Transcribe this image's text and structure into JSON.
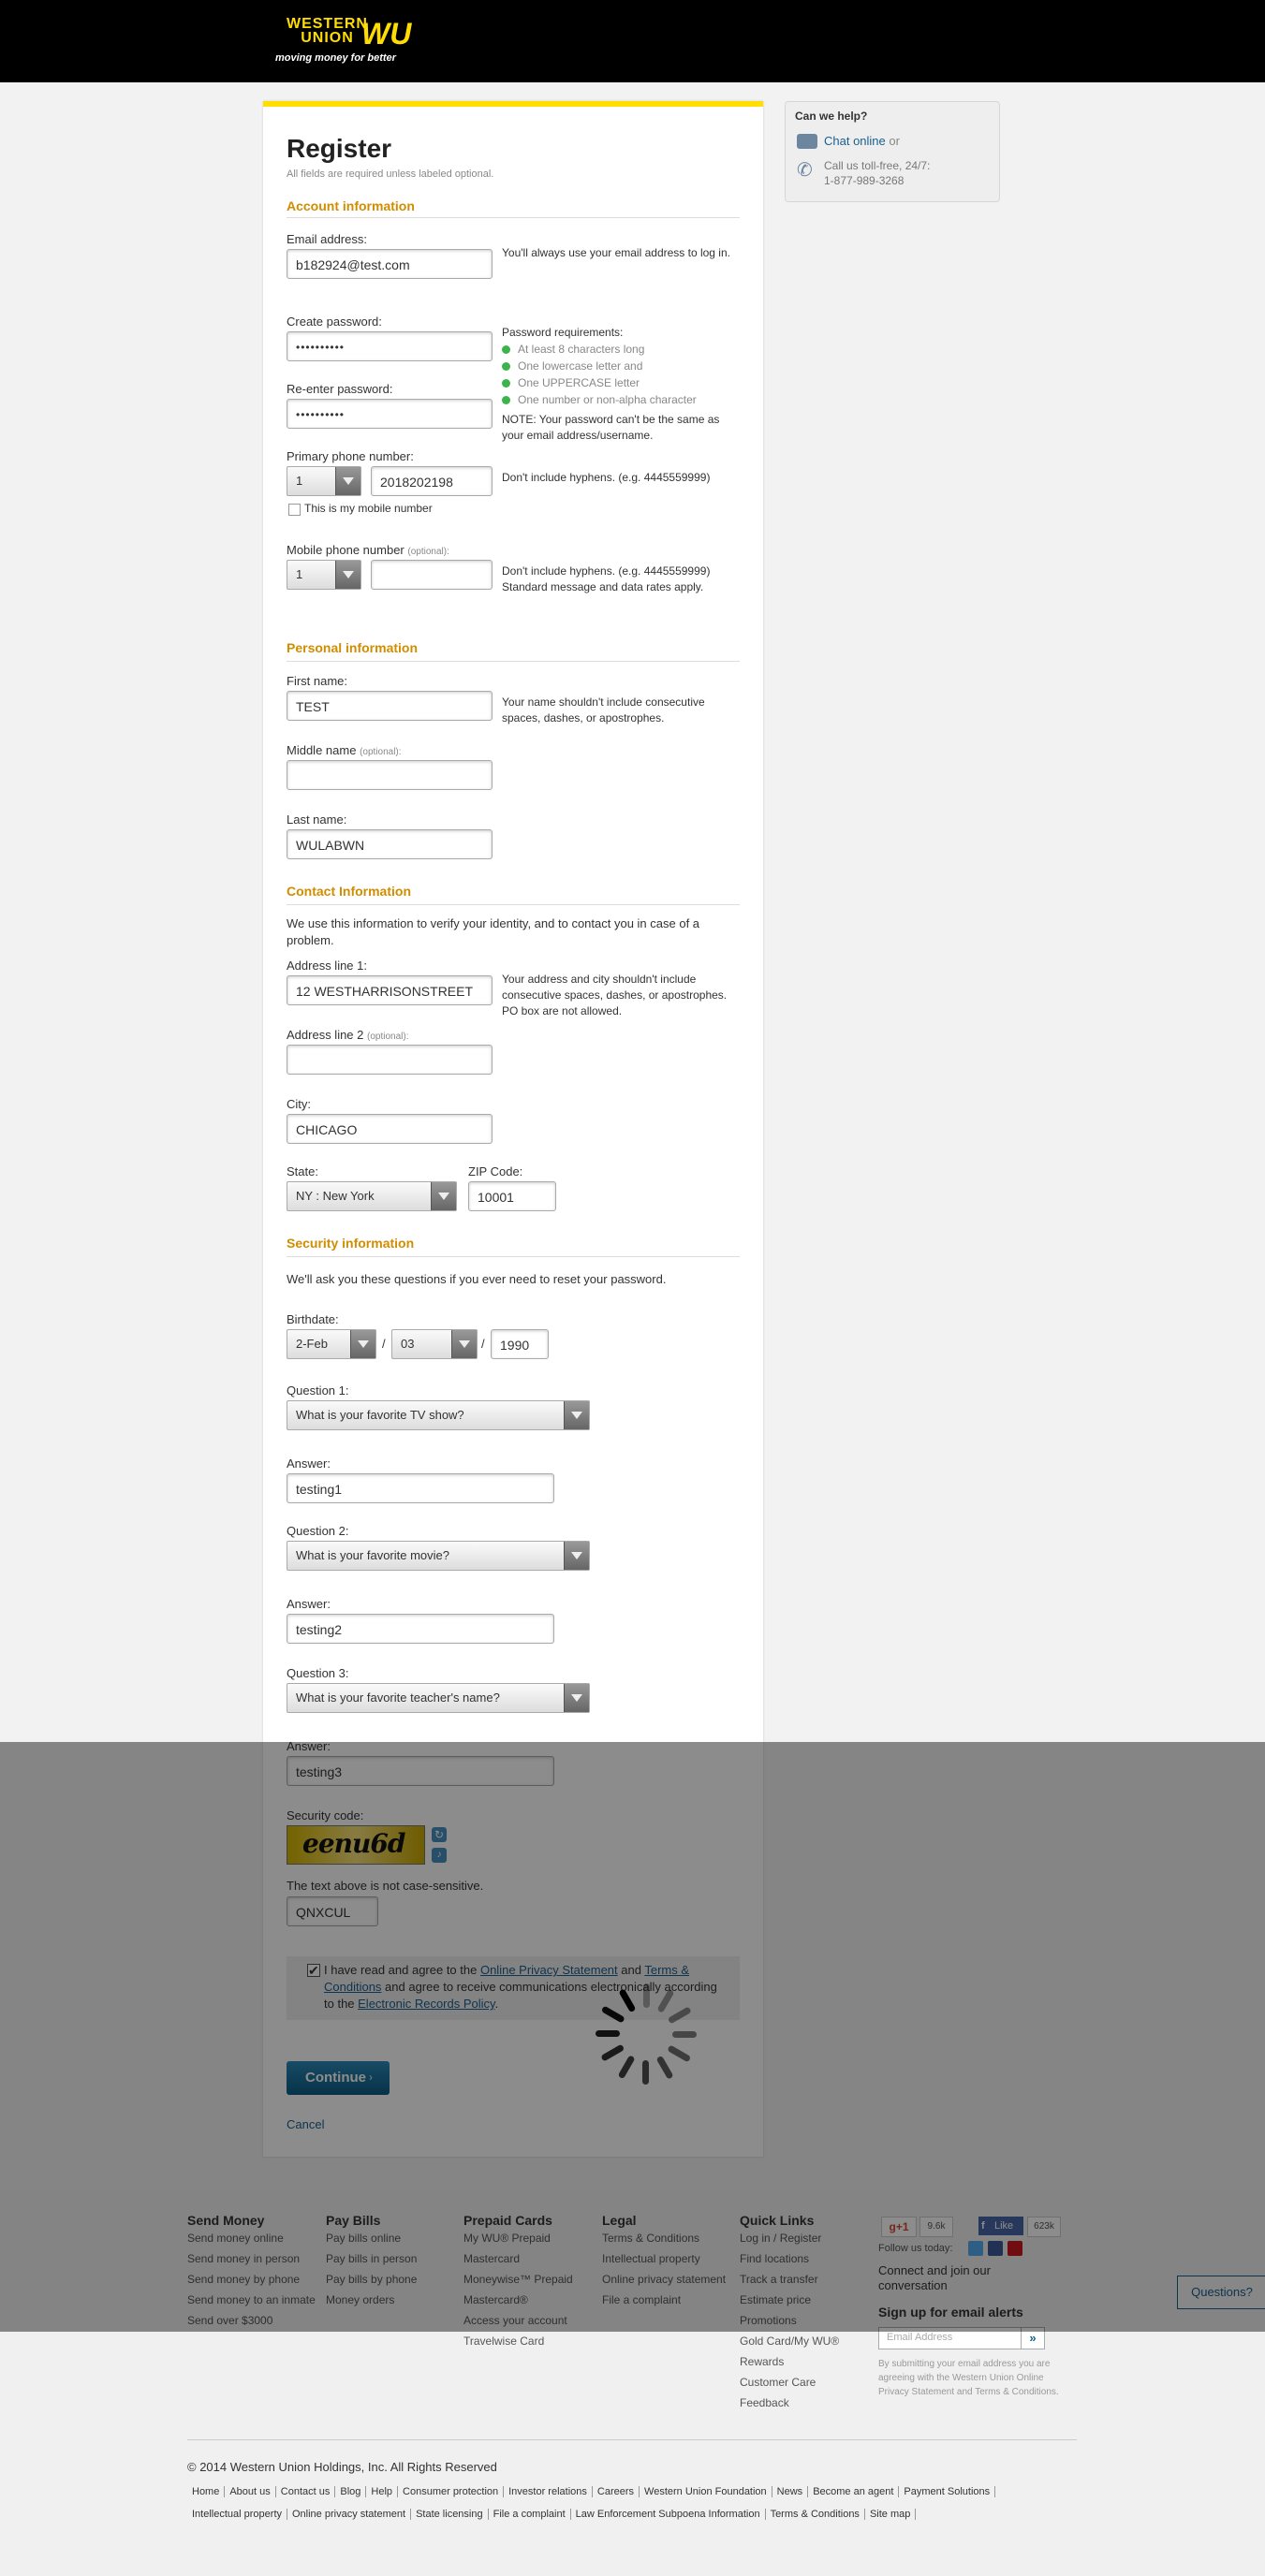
{
  "header": {
    "brand_line1": "WESTERN",
    "brand_line2": "UNION",
    "brand_wu": "WU",
    "tagline": "moving money for better"
  },
  "form": {
    "title": "Register",
    "subtitle": "All fields are required unless labeled optional.",
    "account_heading": "Account information",
    "email_label": "Email address:",
    "email_value": "b182924@test.com",
    "email_help": "You'll always use your email address to log in.",
    "password_label": "Create password:",
    "password_value": "••••••••••",
    "reenter_label": "Re-enter password:",
    "reenter_value": "••••••••••",
    "pw_req_title": "Password requirements:",
    "pw_reqs": [
      "At least 8 characters long",
      "One lowercase letter and",
      "One UPPERCASE letter",
      "One number or non-alpha character"
    ],
    "pw_note_line1": "NOTE: Your password can't be the same as",
    "pw_note_line2": "your email address/username.",
    "primary_phone_label": "Primary phone number:",
    "primary_cc": "1",
    "primary_phone_value": "2018202198",
    "phone_help": "Don't include hyphens. (e.g. 4445559999)",
    "mobile_check_label": "This is my mobile number",
    "mobile_label": "Mobile phone number",
    "optional": "(optional):",
    "mobile_cc": "1",
    "mobile_value": "",
    "mobile_help_line1": "Don't include hyphens. (e.g. 4445559999)",
    "mobile_help_line2": "Standard message and data rates apply.",
    "personal_heading": "Personal information",
    "first_label": "First name:",
    "first_value": "TEST",
    "name_help_line1": "Your name shouldn't include consecutive",
    "name_help_line2": "spaces, dashes, or apostrophes.",
    "middle_label": "Middle name",
    "middle_value": "",
    "last_label": "Last name:",
    "last_value": "WULABWN",
    "contact_heading": "Contact Information",
    "contact_desc_line1": "We use this information to verify your identity, and to contact you in case of a",
    "contact_desc_line2": "problem.",
    "addr1_label": "Address line 1:",
    "addr1_value": "12 WESTHARRISONSTREET",
    "addr_help_line1": "Your address and city shouldn't include",
    "addr_help_line2": "consecutive spaces, dashes, or apostrophes.",
    "addr_help_line3": "PO box are not allowed.",
    "addr2_label": "Address line 2",
    "addr2_value": "",
    "city_label": "City:",
    "city_value": "CHICAGO",
    "state_label": "State:",
    "state_value": "NY : New York",
    "zip_label": "ZIP Code:",
    "zip_value": "10001",
    "security_heading": "Security information",
    "security_desc": "We'll ask you these questions if you ever need to reset your password.",
    "birth_label": "Birthdate:",
    "birth_month": "2-Feb",
    "birth_day": "03",
    "birth_year": "1990",
    "slash": "/",
    "q1_label": "Question 1:",
    "q1_value": "What is your favorite TV show?",
    "a1_label": "Answer:",
    "a1_value": "testing1",
    "q2_label": "Question 2:",
    "q2_value": "What is your favorite movie?",
    "a2_label": "Answer:",
    "a2_value": "testing2",
    "q3_label": "Question 3:",
    "q3_value": "What is your favorite teacher's name?",
    "a3_label": "Answer:",
    "a3_value": "testing3",
    "security_code_label": "Security code:",
    "captcha_text": "eenu6d",
    "captcha_note": "The text above is not case-sensitive.",
    "captcha_value": "QNXCUL",
    "agree_pre": "I have read and agree to the ",
    "agree_link1": "Online Privacy Statement",
    "agree_and": " and ",
    "agree_link2": "Terms &",
    "agree_link2b": "Conditions",
    "agree_mid": " and agree to receive communications electronically according",
    "agree_to": "to the ",
    "agree_link3": "Electronic Records Policy",
    "agree_end": ".",
    "continue_label": "Continue",
    "cancel_label": "Cancel"
  },
  "sidebar": {
    "title": "Can we help?",
    "chat": "Chat online",
    "chat_or": " or",
    "call_line1": "Call us toll-free, 24/7:",
    "call_line2": "1-877-989-3268"
  },
  "footer": {
    "cols": [
      {
        "title": "Send Money",
        "links": [
          "Send money online",
          "Send money in person",
          "Send money by phone",
          "Send money to an inmate",
          "Send over $3000"
        ]
      },
      {
        "title": "Pay Bills",
        "links": [
          "Pay bills online",
          "Pay bills in person",
          "Pay bills by phone",
          "Money orders"
        ]
      },
      {
        "title": "Prepaid Cards",
        "links": [
          "My WU® Prepaid",
          "Mastercard",
          "Moneywise™ Prepaid",
          "Mastercard®",
          "Access your account",
          "Travelwise Card"
        ]
      },
      {
        "title": "Legal",
        "links": [
          "Terms & Conditions",
          "Intellectual property",
          "Online privacy statement",
          "File a complaint"
        ]
      },
      {
        "title": "Quick Links",
        "links": [
          "Log in / Register",
          "Find locations",
          "Track a transfer",
          "Estimate price",
          "Promotions",
          "Gold Card/My WU®",
          "Rewards",
          "Customer Care",
          "Feedback"
        ]
      }
    ],
    "gplus": "g+1",
    "gcount": "9.6k",
    "fb_like": "Like",
    "fb_count": "623k",
    "follow": "Follow us today:",
    "connect_line1": "Connect and join our",
    "connect_line2": "conversation",
    "signup": "Sign up for email alerts",
    "email_placeholder": "Email Address",
    "disclaimer_line1": "By submitting your email address you are",
    "disclaimer_line2": "agreeing with the Western Union Online",
    "disclaimer_line3": "Privacy Statement and Terms & Conditions.",
    "questions": "Questions?",
    "copyright": "© 2014 Western Union Holdings, Inc. All Rights Reserved",
    "links_row1": [
      "Home",
      "About us",
      "Contact us",
      "Blog",
      "Help",
      "Consumer protection",
      "Investor relations",
      "Careers",
      "Western Union Foundation",
      "News",
      "Become an agent",
      "Payment Solutions"
    ],
    "links_row2": [
      "Intellectual property",
      "Online privacy statement",
      "State licensing",
      "File a complaint",
      "Law Enforcement Subpoena Information",
      "Terms & Conditions",
      "Site map"
    ]
  }
}
